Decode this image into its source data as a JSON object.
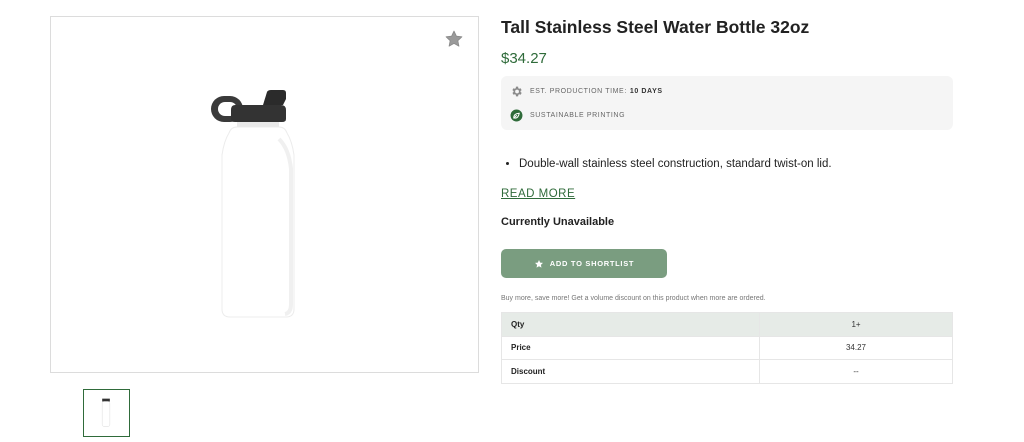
{
  "product": {
    "title": "Tall Stainless Steel Water Bottle 32oz",
    "price": "$34.27",
    "production_label": "EST. PRODUCTION TIME:",
    "production_value": "10 DAYS",
    "sustainable_label": "SUSTAINABLE PRINTING",
    "bullets": [
      "Double-wall stainless steel construction, standard twist-on lid."
    ],
    "read_more": "READ MORE",
    "availability": "Currently Unavailable",
    "shortlist_button": "ADD TO SHORTLIST",
    "volume_note": "Buy more, save more! Get a volume discount on this product when more are ordered."
  },
  "pricing_table": {
    "rows": [
      {
        "key": "Qty",
        "value": "1+"
      },
      {
        "key": "Price",
        "value": "34.27"
      },
      {
        "key": "Discount",
        "value": "--"
      }
    ]
  },
  "icons": {
    "favorite": "star-icon",
    "production": "gear-icon",
    "sustainable": "leaf-icon",
    "shortlist": "star-icon"
  },
  "colors": {
    "accent_green": "#2f6b3a",
    "button_green": "#7a9d80",
    "table_header": "#e6ebe7"
  }
}
